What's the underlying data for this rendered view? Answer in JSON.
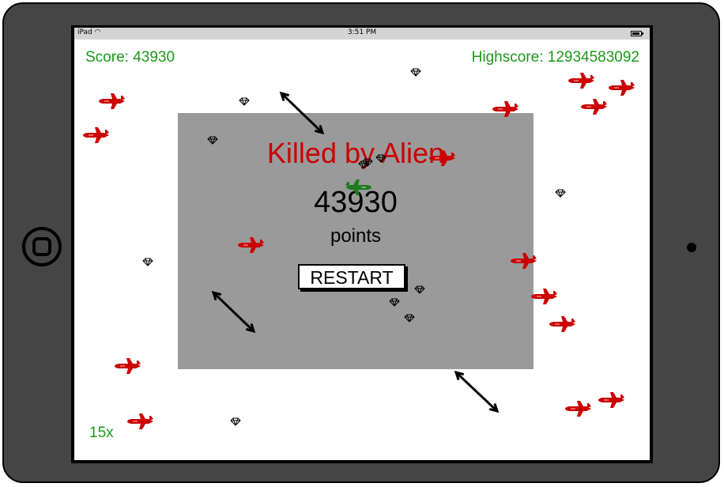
{
  "status_bar": {
    "device": "iPad",
    "time": "3:51 PM"
  },
  "hud": {
    "score": "Score: 43930",
    "highscore": "Highscore: 12934583092",
    "multiplier": "15x"
  },
  "game_over": {
    "title": "Killed by Alien",
    "score": "43930",
    "points_label": "points",
    "restart_label": "RESTART"
  },
  "colors": {
    "hud_text": "#1a9a1a",
    "enemy": "#cc0000",
    "player": "#1e7a1e",
    "overlay": "#9a9a9a",
    "title": "#cc0000"
  },
  "icons": {
    "enemy": "red-fighter-jet-icon",
    "player": "green-fighter-jet-icon",
    "gem": "diamond-icon",
    "resize": "double-arrow-icon"
  }
}
